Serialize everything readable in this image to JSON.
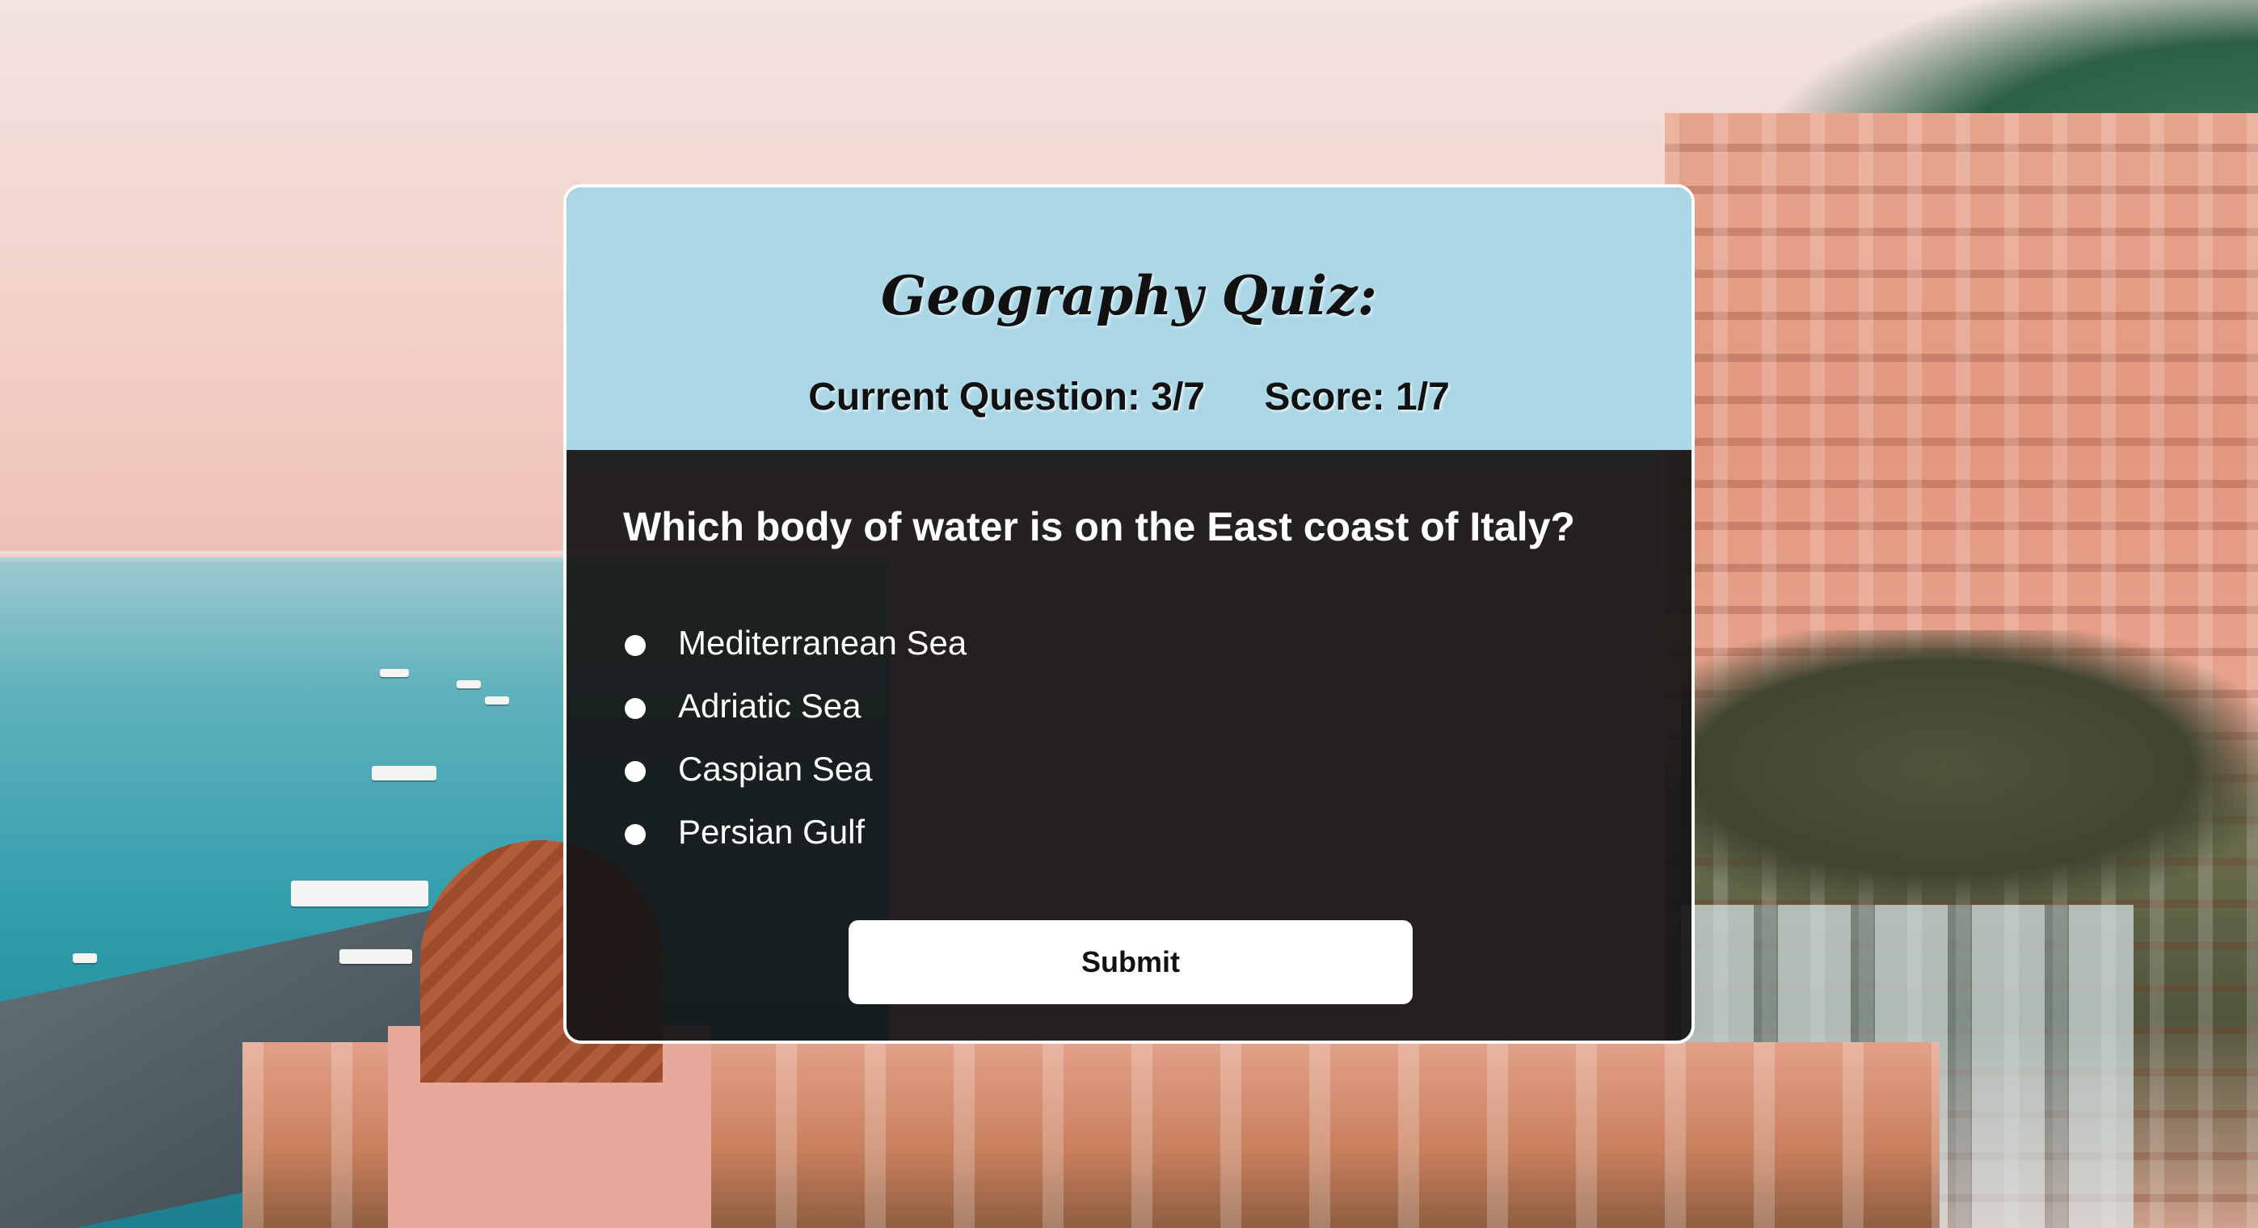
{
  "quiz": {
    "title": "Geography Quiz:",
    "current_question": "Current Question: 3/7",
    "score": "Score: 1/7",
    "question": "Which body of water is on the East coast of Italy?",
    "options": [
      {
        "label": "Mediterranean Sea",
        "selected": false
      },
      {
        "label": "Adriatic Sea",
        "selected": false
      },
      {
        "label": "Caspian Sea",
        "selected": false
      },
      {
        "label": "Persian Gulf",
        "selected": false
      }
    ],
    "submit_label": "Submit"
  },
  "colors": {
    "header_bg": "#aad6e6",
    "body_bg": "#141414",
    "text_light": "#ffffff",
    "text_dark": "#111111"
  }
}
